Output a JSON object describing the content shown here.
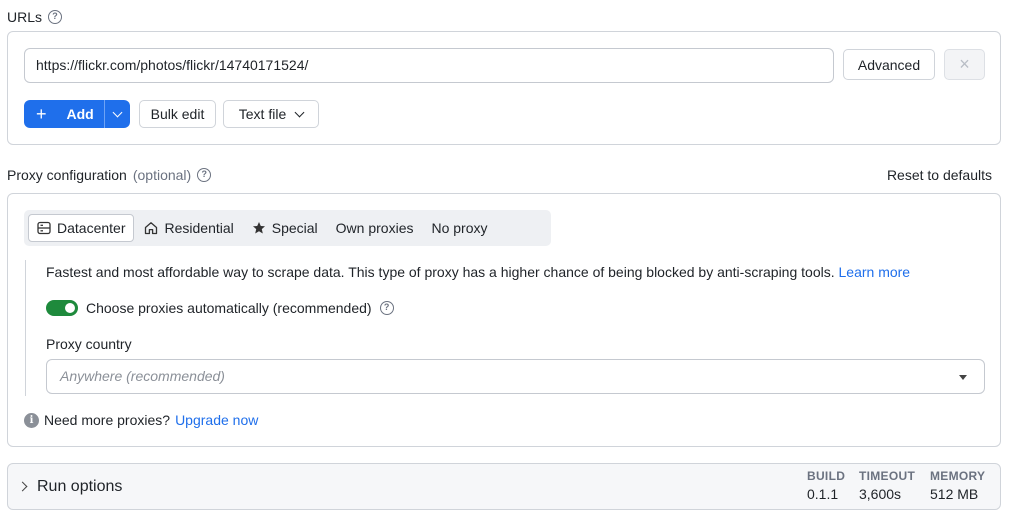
{
  "urls": {
    "label": "URLs",
    "input_value": "https://flickr.com/photos/flickr/14740171524/",
    "advanced_label": "Advanced",
    "remove_label": "×",
    "add_label": "Add",
    "add_plus": "+",
    "bulk_edit_label": "Bulk edit",
    "text_file_label": "Text file"
  },
  "proxy": {
    "label": "Proxy configuration",
    "optional": "(optional)",
    "reset_label": "Reset to defaults",
    "tabs": [
      {
        "label": "Datacenter",
        "icon": "server-icon",
        "active": true
      },
      {
        "label": "Residential",
        "icon": "home-icon",
        "active": false
      },
      {
        "label": "Special",
        "icon": "star-icon",
        "active": false
      },
      {
        "label": "Own proxies",
        "icon": "",
        "active": false
      },
      {
        "label": "No proxy",
        "icon": "",
        "active": false
      }
    ],
    "description": "Fastest and most affordable way to scrape data. This type of proxy has a higher chance of being blocked by anti-scraping tools.",
    "learn_more": "Learn more",
    "auto_label": "Choose proxies automatically (recommended)",
    "auto_enabled": true,
    "country_label": "Proxy country",
    "country_placeholder": "Anywhere (recommended)",
    "more_proxies_text": "Need more proxies?",
    "upgrade_label": "Upgrade now"
  },
  "run_options": {
    "title": "Run options",
    "build_label": "BUILD",
    "build_value": "0.1.1",
    "timeout_label": "TIMEOUT",
    "timeout_value": "3,600s",
    "memory_label": "MEMORY",
    "memory_value": "512 MB"
  },
  "colors": {
    "primary": "#1f6feb",
    "toggle_on": "#1e8a3c",
    "link": "#1f6feb"
  }
}
